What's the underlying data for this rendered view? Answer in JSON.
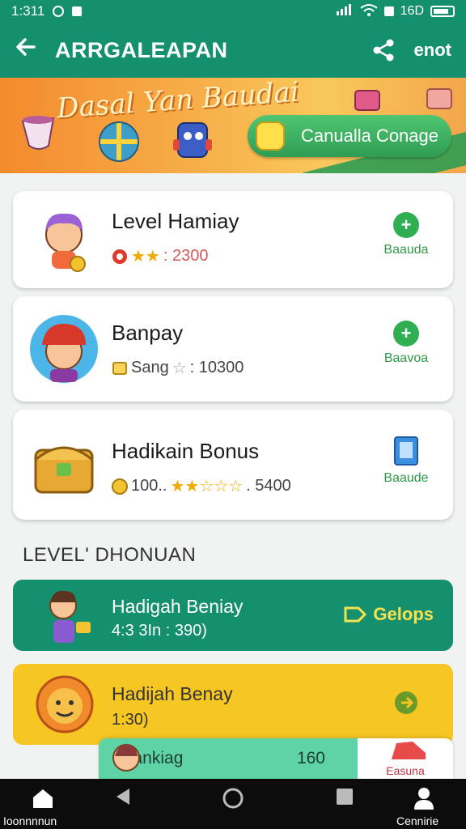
{
  "status_bar": {
    "time": "1:311",
    "battery_text": "16D"
  },
  "app_bar": {
    "title": "ARRGALEAPAN",
    "action": "enot"
  },
  "banner": {
    "script_text": "Dasal Yan Baudai",
    "cta_label": "Canualla Conage"
  },
  "cards": [
    {
      "name": "Level Hamiay",
      "meta_prefix": "",
      "stars": "★★",
      "meta_value": ": 2300",
      "action_label": "Baauda",
      "action_icon": "plus-circle-icon"
    },
    {
      "name": "Banpay",
      "meta_prefix": "Sang",
      "stars": "☆",
      "meta_value": ": 10300",
      "action_label": "Baavoa",
      "action_icon": "plus-circle-icon"
    },
    {
      "name": "Hadikain Bonus",
      "meta_prefix": "100..",
      "stars": "★★☆☆☆",
      "meta_value": ". 5400",
      "action_label": "Baaude",
      "action_icon": "clipboard-icon"
    }
  ],
  "section_title": "LEVEL' DHONUAN",
  "bands": [
    {
      "name": "Hadigah Beniay",
      "meta": "4:3 3In : 390)",
      "pill": "Gelops"
    },
    {
      "name": "Hadijah Benay",
      "meta": "1:30)"
    }
  ],
  "mini_bar": {
    "label": "Mrankiag",
    "value": "160",
    "right_label": "Easuna"
  },
  "nav": {
    "left_label": "Ioonnnnun",
    "right_label": "Cennirie"
  },
  "colors": {
    "primary": "#15906f",
    "accent_green": "#2fae52",
    "yellow": "#f6c623"
  }
}
